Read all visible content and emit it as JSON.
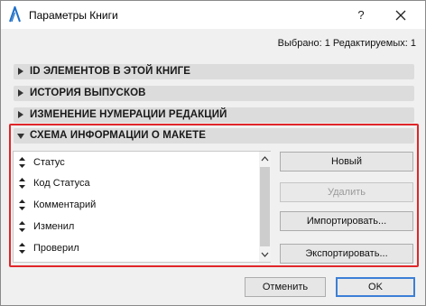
{
  "window": {
    "title": "Параметры Книги",
    "help_label": "?",
    "app_icon": "archicad-icon",
    "close_icon": "close-icon"
  },
  "selection_info": "Выбрано: 1 Редактируемых: 1",
  "sections": [
    {
      "label": "ID ЭЛЕМЕНТОВ В ЭТОЙ КНИГЕ",
      "expanded": false
    },
    {
      "label": "ИСТОРИЯ ВЫПУСКОВ",
      "expanded": false
    },
    {
      "label": "ИЗМЕНЕНИЕ НУМЕРАЦИИ РЕДАКЦИЙ",
      "expanded": false
    },
    {
      "label": "СХЕМА ИНФОРМАЦИИ О МАКЕТЕ",
      "expanded": true
    }
  ],
  "layout_info": {
    "items": [
      {
        "label": "Статус"
      },
      {
        "label": "Код Статуса"
      },
      {
        "label": "Комментарий"
      },
      {
        "label": "Изменил"
      },
      {
        "label": "Проверил"
      }
    ],
    "buttons": {
      "new": "Новый",
      "delete": "Удалить",
      "import": "Импортировать...",
      "export": "Экспортировать..."
    }
  },
  "footer": {
    "cancel": "Отменить",
    "ok": "OK"
  },
  "colors": {
    "highlight": "#e0262a",
    "primary_border": "#3c7fd6"
  }
}
